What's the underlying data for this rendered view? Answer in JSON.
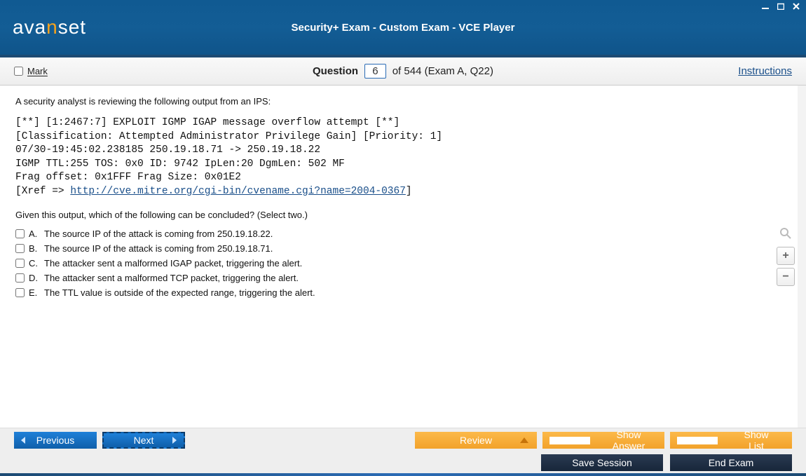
{
  "header": {
    "brand_a": "ava",
    "brand_n": "n",
    "brand_b": "set",
    "title": "Security+ Exam - Custom Exam - VCE Player"
  },
  "toolbar": {
    "mark_label": "Mark",
    "question_label": "Question",
    "question_number": "6",
    "question_total": "of 544 (Exam A, Q22)",
    "instructions_label": "Instructions"
  },
  "question": {
    "prompt": "A security analyst is reviewing the following output from an IPS:",
    "ips_pre": "[**] [1:2467:7] EXPLOIT IGMP IGAP message overflow attempt [**]\n[Classification: Attempted Administrator Privilege Gain] [Priority: 1]\n07/30-19:45:02.238185 250.19.18.71 -> 250.19.18.22\nIGMP TTL:255 TOS: 0x0 ID: 9742 IpLen:20 DgmLen: 502 MF\nFrag offset: 0x1FFF Frag Size: 0x01E2\n[Xref => ",
    "ips_link": "http://cve.mitre.org/cgi-bin/cvename.cgi?name=2004-0367",
    "ips_post": "]",
    "subprompt": "Given this output, which of the following can be concluded? (Select two.)",
    "options": [
      {
        "letter": "A.",
        "text": "The source IP of the attack is coming from 250.19.18.22."
      },
      {
        "letter": "B.",
        "text": "The source IP of the attack is coming from 250.19.18.71."
      },
      {
        "letter": "C.",
        "text": "The attacker sent a malformed IGAP packet, triggering the alert."
      },
      {
        "letter": "D.",
        "text": "The attacker sent a malformed TCP packet, triggering the alert."
      },
      {
        "letter": "E.",
        "text": "The TTL value is outside of the expected range, triggering the alert."
      }
    ]
  },
  "nav": {
    "previous": "Previous",
    "next": "Next",
    "review": "Review",
    "show_answer": "Show Answer",
    "show_list": "Show List"
  },
  "bottom": {
    "save_session": "Save Session",
    "end_exam": "End Exam"
  },
  "zoom": {
    "plus": "+",
    "minus": "−"
  }
}
